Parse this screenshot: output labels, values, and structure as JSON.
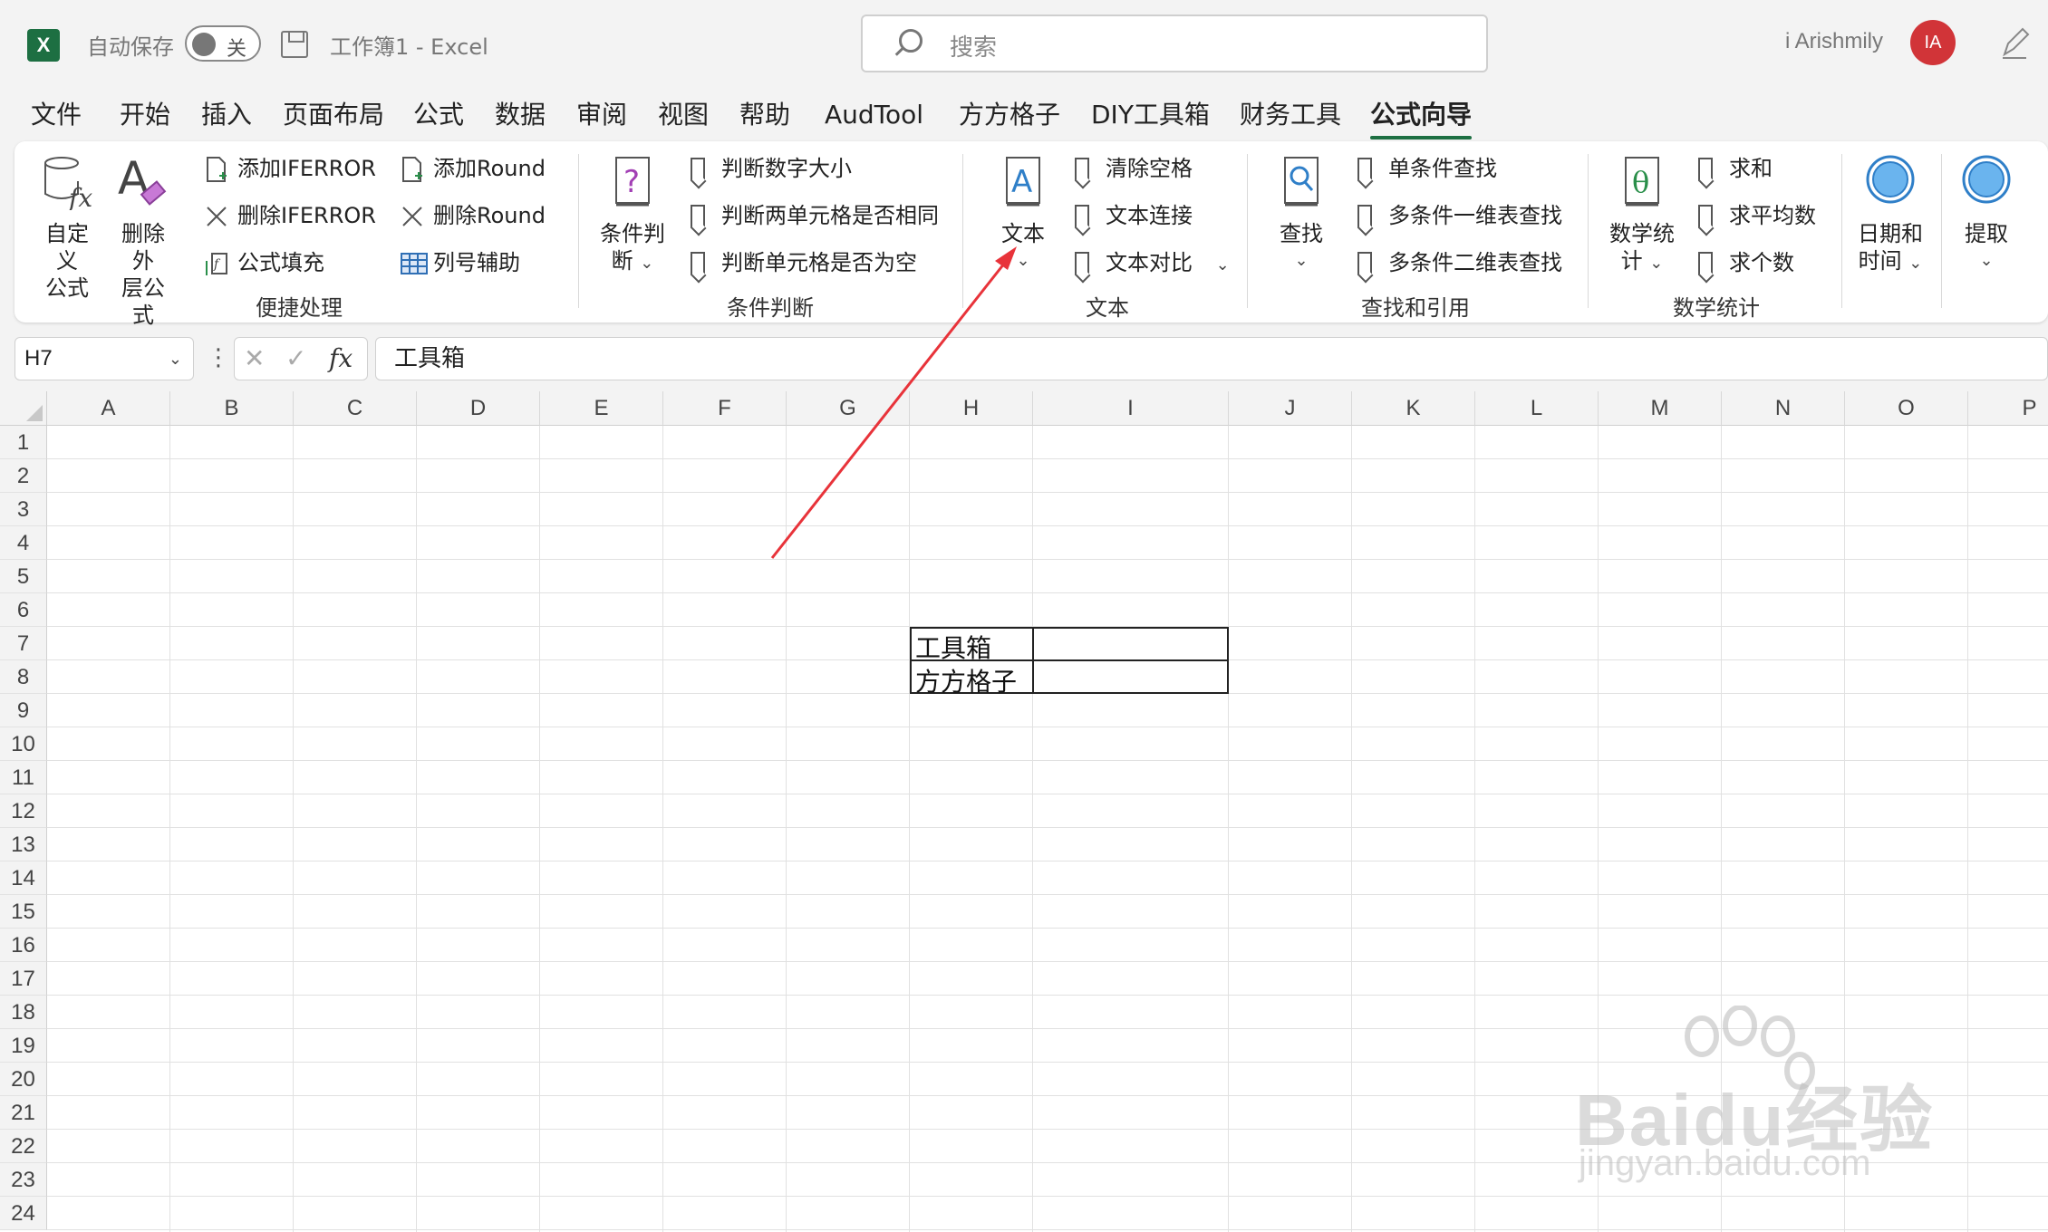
{
  "titlebar": {
    "app_icon": "excel-icon",
    "autosave_label": "自动保存",
    "autosave_state": "关",
    "workbook_title": "工作簿1  -  Excel",
    "search_placeholder": "搜索",
    "user_name": "i Arishmily",
    "avatar_initials": "IA"
  },
  "tabs": [
    {
      "label": "文件"
    },
    {
      "label": "开始"
    },
    {
      "label": "插入"
    },
    {
      "label": "页面布局"
    },
    {
      "label": "公式"
    },
    {
      "label": "数据"
    },
    {
      "label": "审阅"
    },
    {
      "label": "视图"
    },
    {
      "label": "帮助"
    },
    {
      "label": "AudTool"
    },
    {
      "label": "方方格子"
    },
    {
      "label": "DIY工具箱"
    },
    {
      "label": "财务工具"
    },
    {
      "label": "公式向导",
      "active": true
    }
  ],
  "ribbon": {
    "group1": {
      "label": "便捷处理",
      "custom_formula": "自定义\n公式",
      "remove_outer": "删除外\n层公式",
      "add_iferror": "添加IFERROR",
      "del_iferror": "删除IFERROR",
      "fill_formula": "公式填充",
      "add_round": "添加Round",
      "del_round": "删除Round",
      "col_helper": "列号辅助"
    },
    "group2": {
      "label": "条件判断",
      "cond_judge": "条件判\n断",
      "judge_size": "判断数字大小",
      "judge_same": "判断两单元格是否相同",
      "judge_empty": "判断单元格是否为空"
    },
    "group3": {
      "label": "文本",
      "text": "文本",
      "clear_space": "清除空格",
      "text_join": "文本连接",
      "text_compare": "文本对比"
    },
    "group4": {
      "label": "查找和引用",
      "find": "查找",
      "single_find": "单条件查找",
      "multi_1d": "多条件一维表查找",
      "multi_2d": "多条件二维表查找"
    },
    "group5": {
      "label": "数学统计",
      "math": "数学统\n计",
      "sum": "求和",
      "avg": "求平均数",
      "count": "求个数"
    },
    "group6": {
      "datetime": "日期和\n时间"
    },
    "group7": {
      "extract": "提取"
    }
  },
  "formula_bar": {
    "name_box": "H7",
    "content": "工具箱"
  },
  "sheet": {
    "columns": [
      "A",
      "B",
      "C",
      "D",
      "E",
      "F",
      "G",
      "H",
      "I",
      "J",
      "K",
      "L",
      "M",
      "N",
      "O",
      "P"
    ],
    "rows": [
      "1",
      "2",
      "3",
      "4",
      "5",
      "6",
      "7",
      "8",
      "9",
      "10",
      "11",
      "12",
      "13",
      "14",
      "15",
      "16",
      "17",
      "18",
      "19",
      "20",
      "21",
      "22",
      "23",
      "24"
    ],
    "cells": {
      "H7": "工具箱",
      "H8": "方方格子"
    }
  },
  "watermark": {
    "brand": "Baidu经验",
    "url": "jingyan.baidu.com"
  },
  "colors": {
    "accent": "#1d6f42",
    "annotation_arrow": "#e8333a",
    "avatar": "#d13438"
  }
}
